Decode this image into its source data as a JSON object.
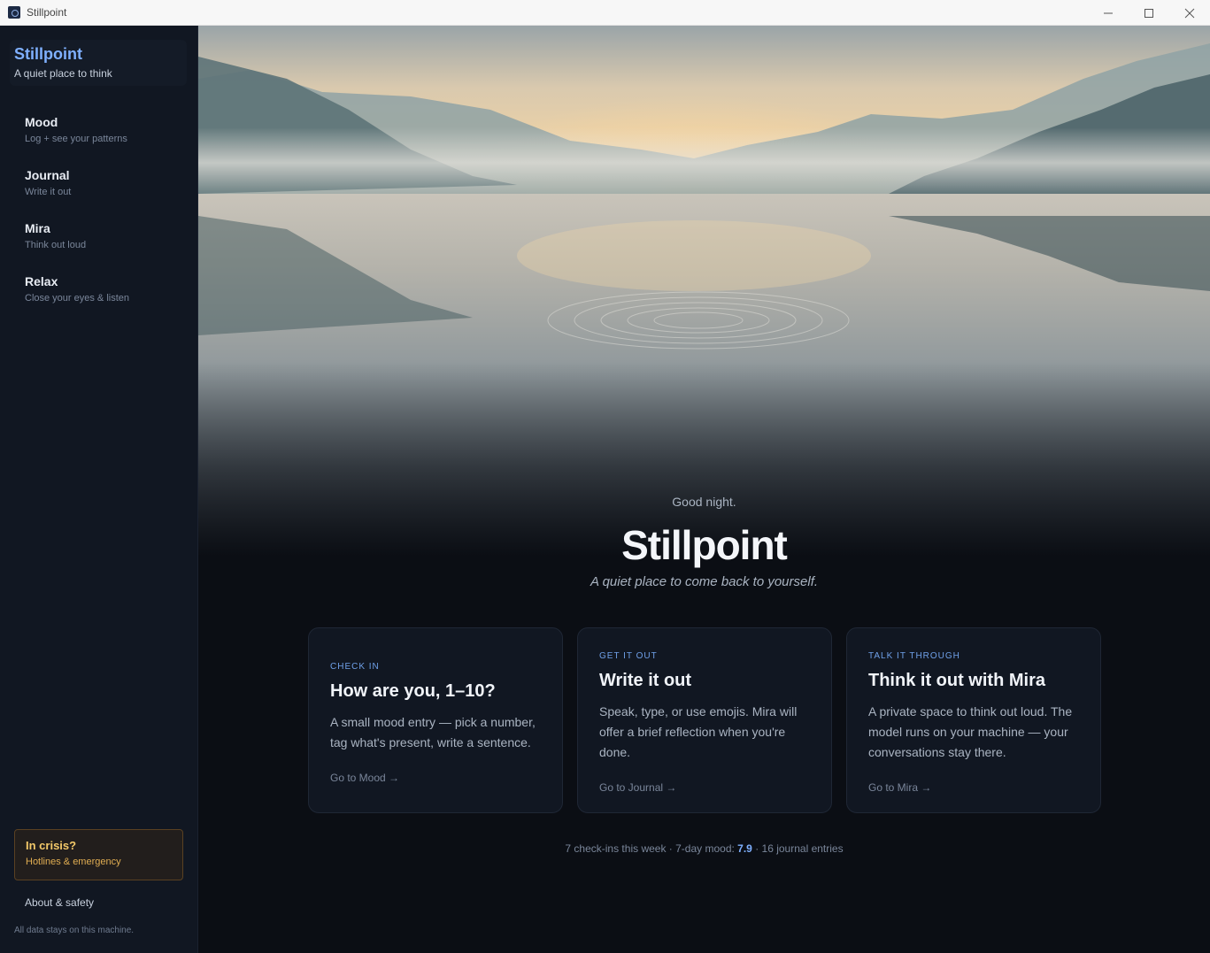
{
  "window": {
    "title": "Stillpoint"
  },
  "sidebar": {
    "brand_name": "Stillpoint",
    "brand_tagline": "A quiet place to think",
    "items": [
      {
        "label": "Mood",
        "sub": "Log + see your patterns"
      },
      {
        "label": "Journal",
        "sub": "Write it out"
      },
      {
        "label": "Mira",
        "sub": "Think out loud"
      },
      {
        "label": "Relax",
        "sub": "Close your eyes & listen"
      }
    ],
    "crisis": {
      "title": "In crisis?",
      "sub": "Hotlines & emergency"
    },
    "about": "About & safety",
    "privacy": "All data stays on this machine."
  },
  "hero": {
    "greeting": "Good night.",
    "title": "Stillpoint",
    "tagline": "A quiet place to come back to yourself."
  },
  "cards": [
    {
      "eyebrow": "CHECK IN",
      "title": "How are you, 1–10?",
      "desc": "A small mood entry — pick a number, tag what's present, write a sentence.",
      "link": "Go to Mood →"
    },
    {
      "eyebrow": "GET IT OUT",
      "title": "Write it out",
      "desc": "Speak, type, or use emojis. Mira will offer a brief reflection when you're done.",
      "link": "Go to Journal →"
    },
    {
      "eyebrow": "TALK IT THROUGH",
      "title": "Think it out with Mira",
      "desc": "A private space to think out loud. The model runs on your machine — your conversations stay there.",
      "link": "Go to Mira →"
    }
  ],
  "stats": {
    "checkins": "7 check-ins this week",
    "sep1": " · ",
    "mood_label": "7-day mood: ",
    "mood_value": "7.9",
    "sep2": " · ",
    "journal": "16 journal entries"
  },
  "colors": {
    "accent": "#7fb0ff",
    "crisis": "#f3c969",
    "background": "#0b0e14",
    "sidebar": "#111722"
  },
  "icons": {
    "app": "stillpoint-logo-icon",
    "minimize": "minimize-icon",
    "maximize": "maximize-icon",
    "close": "close-icon"
  }
}
